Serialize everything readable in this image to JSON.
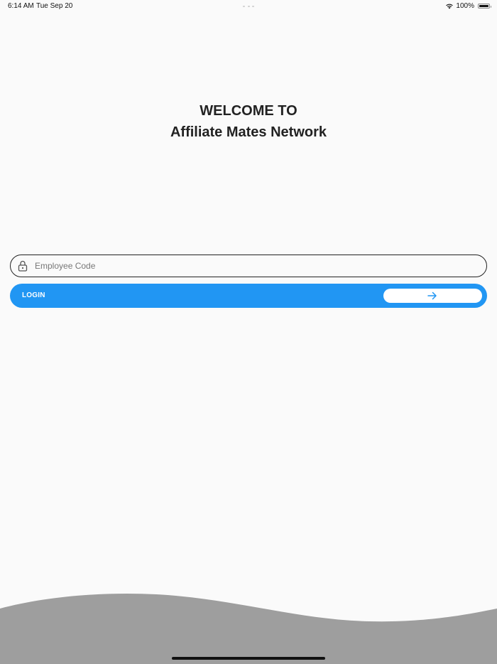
{
  "status_bar": {
    "time": "6:14 AM",
    "date": "Tue Sep 20",
    "battery": "100%",
    "wifi_icon": "wifi-icon",
    "battery_icon": "battery-icon"
  },
  "header": {
    "line1": "WELCOME TO",
    "line2": "Affiliate Mates Network"
  },
  "login_form": {
    "employee_code_placeholder": "Employee Code",
    "employee_code_value": "",
    "lock_icon": "lock-icon",
    "login_label": "LOGIN",
    "arrow_icon": "arrow-right-icon"
  },
  "colors": {
    "primary": "#2196f3",
    "background": "#fafafa",
    "wave": "#9e9e9e",
    "text": "#222222"
  }
}
